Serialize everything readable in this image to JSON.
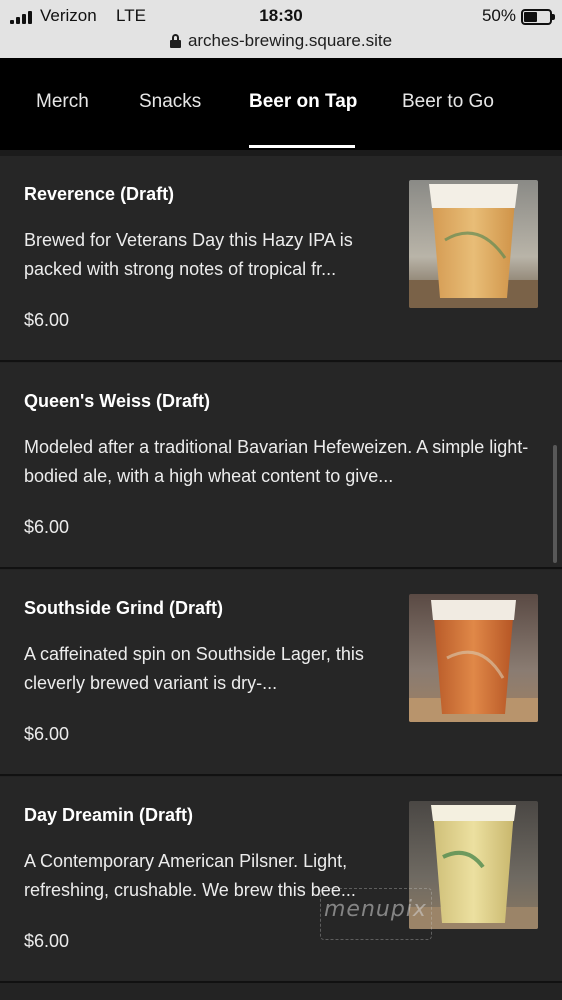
{
  "status_bar": {
    "carrier": "Verizon",
    "network": "LTE",
    "time": "18:30",
    "battery_percent": "50%",
    "battery_level": 0.5
  },
  "url_bar": {
    "domain": "arches-brewing.square.site",
    "lock_icon": "lock-icon"
  },
  "nav": {
    "tabs": [
      {
        "label": "Merch",
        "active": false
      },
      {
        "label": "Snacks",
        "active": false
      },
      {
        "label": "Beer on Tap",
        "active": true
      },
      {
        "label": "Beer to Go",
        "active": false
      }
    ]
  },
  "menu": {
    "items": [
      {
        "name": "Reverence (Draft)",
        "description": "Brewed for Veterans Day this Hazy IPA is packed with strong notes of tropical fr...",
        "price": "$6.00",
        "has_photo": true
      },
      {
        "name": "Queen's Weiss (Draft)",
        "description": "Modeled after a traditional Bavarian Hefeweizen. A simple light-bodied ale, with a high wheat content to give...",
        "price": "$6.00",
        "has_photo": false
      },
      {
        "name": "Southside Grind (Draft)",
        "description": "A caffeinated spin on Southside Lager, this cleverly brewed variant is dry-...",
        "price": "$6.00",
        "has_photo": true
      },
      {
        "name": "Day Dreamin (Draft)",
        "description": "A Contemporary American Pilsner. Light, refreshing, crushable. We brew this bee...",
        "price": "$6.00",
        "has_photo": true
      }
    ]
  },
  "watermark": "menupix",
  "colors": {
    "nav_background": "#000000",
    "item_background": "#262626",
    "status_background": "#e3e3e3",
    "hazy_ipa": "#e0b067",
    "amber_lager": "#d0743a",
    "pilsner": "#e4d690"
  }
}
